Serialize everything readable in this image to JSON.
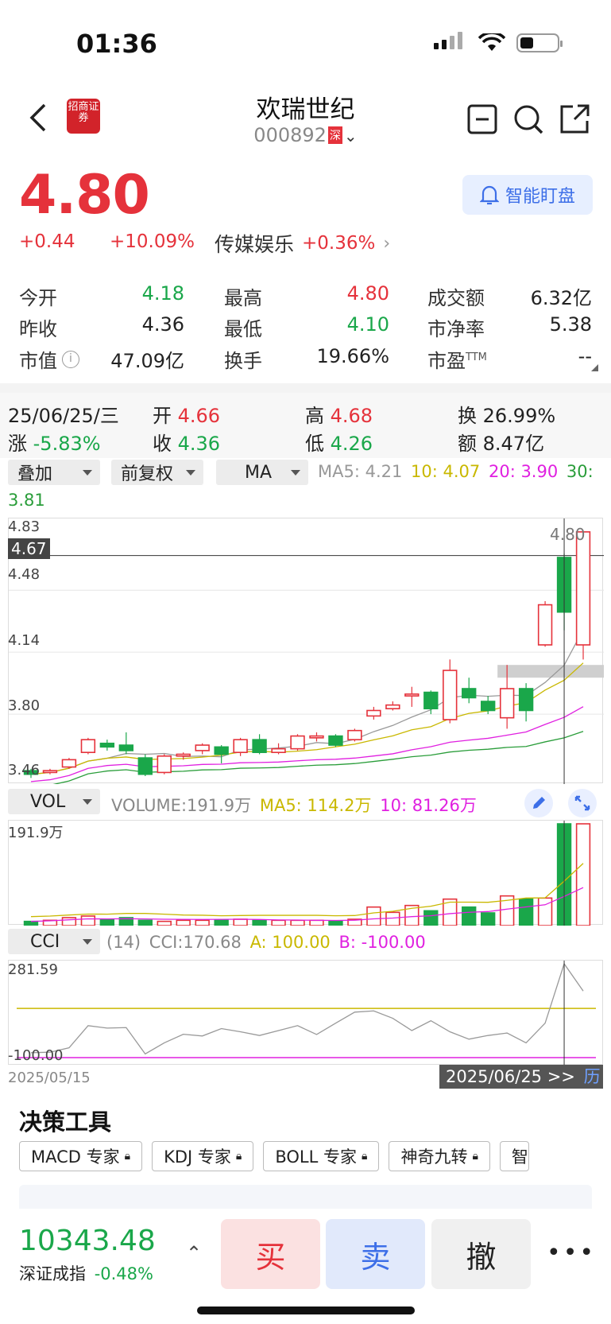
{
  "status": {
    "time": "01:36"
  },
  "header": {
    "title": "欢瑞世纪",
    "code": "000892",
    "exchange_tag": "深",
    "broker_logo_text": "招商证券"
  },
  "quote": {
    "price": "4.80",
    "change": "+0.44",
    "change_pct": "+10.09%",
    "sector": "传媒娱乐",
    "sector_pct": "+0.36%",
    "smart_watch": "智能盯盘"
  },
  "stats": [
    {
      "label": "今开",
      "value": "4.18",
      "color": "green"
    },
    {
      "label": "最高",
      "value": "4.80",
      "color": "red"
    },
    {
      "label": "成交额",
      "value": "6.32亿",
      "color": "black"
    },
    {
      "label": "昨收",
      "value": "4.36",
      "color": "black"
    },
    {
      "label": "最低",
      "value": "4.10",
      "color": "green"
    },
    {
      "label": "市净率",
      "value": "5.38",
      "color": "black"
    },
    {
      "label": "市值",
      "value": "47.09亿",
      "color": "black"
    },
    {
      "label": "换手",
      "value": "19.66%",
      "color": "black"
    },
    {
      "label": "市盈",
      "value": "--",
      "color": "black"
    }
  ],
  "pe_sup": "TTM",
  "day_info": {
    "date": "25/06/25/三",
    "open_label": "开",
    "open": "4.66",
    "high_label": "高",
    "high": "4.68",
    "turnover_label": "换",
    "turnover": "26.99%",
    "chg_label": "涨",
    "chg": "-5.83%",
    "close_label": "收",
    "close": "4.36",
    "low_label": "低",
    "low": "4.26",
    "amount_label": "额",
    "amount": "8.47亿"
  },
  "kline_controls": {
    "overlay": "叠加",
    "adjust": "前复权",
    "indicator": "MA",
    "ma5": "MA5: 4.21",
    "ma10": "10: 4.07",
    "ma20": "20: 3.90",
    "ma30_a": "30:",
    "ma30_b": "3.81"
  },
  "price_axis": {
    "top": "4.83",
    "cursor": "4.67",
    "l2": "4.48",
    "l3": "4.14",
    "l4": "3.80",
    "bottom": "3.46",
    "max_label": "4.80"
  },
  "vol_panel": {
    "selector": "VOL",
    "volume": "VOLUME:191.9万",
    "ma5": "MA5: 114.2万",
    "ma10": "10: 81.26万",
    "axis_top": "191.9万"
  },
  "cci_panel": {
    "selector": "CCI",
    "period": "(14)",
    "cci": "CCI:170.68",
    "a": "A: 100.00",
    "b": "B: -100.00",
    "axis_top": "281.59",
    "axis_bottom": "-100.00",
    "date_start": "2025/05/15",
    "date_cursor": "2025/06/25 >>",
    "history": "历"
  },
  "tools": {
    "title": "决策工具",
    "chips": [
      "MACD 专家",
      "KDJ 专家",
      "BOLL 专家",
      "神奇九转",
      "智"
    ]
  },
  "bottom": {
    "index_value": "10343.48",
    "index_name": "深证成指",
    "index_pct": "-0.48%",
    "buy": "买",
    "sell": "卖",
    "cancel": "撤"
  },
  "colors": {
    "up": "#e5323b",
    "down": "#1aa74a",
    "ma5": "#c9b800",
    "ma10": "#e020e0",
    "ma20": "#2a9d3a"
  },
  "chart_data": {
    "type": "candlestick",
    "x": [
      "2025/05/15",
      "2025/06/25"
    ],
    "candles": [
      {
        "o": 3.49,
        "c": 3.47,
        "h": 3.5,
        "l": 3.45
      },
      {
        "o": 3.48,
        "c": 3.49,
        "h": 3.5,
        "l": 3.47
      },
      {
        "o": 3.51,
        "c": 3.55,
        "h": 3.56,
        "l": 3.5
      },
      {
        "o": 3.59,
        "c": 3.66,
        "h": 3.67,
        "l": 3.58
      },
      {
        "o": 3.64,
        "c": 3.62,
        "h": 3.66,
        "l": 3.6
      },
      {
        "o": 3.63,
        "c": 3.6,
        "h": 3.7,
        "l": 3.58
      },
      {
        "o": 3.56,
        "c": 3.47,
        "h": 3.58,
        "l": 3.46
      },
      {
        "o": 3.48,
        "c": 3.57,
        "h": 3.58,
        "l": 3.47
      },
      {
        "o": 3.57,
        "c": 3.58,
        "h": 3.59,
        "l": 3.55
      },
      {
        "o": 3.6,
        "c": 3.63,
        "h": 3.64,
        "l": 3.58
      },
      {
        "o": 3.62,
        "c": 3.58,
        "h": 3.63,
        "l": 3.53
      },
      {
        "o": 3.59,
        "c": 3.66,
        "h": 3.67,
        "l": 3.57
      },
      {
        "o": 3.66,
        "c": 3.59,
        "h": 3.69,
        "l": 3.58
      },
      {
        "o": 3.59,
        "c": 3.61,
        "h": 3.64,
        "l": 3.58
      },
      {
        "o": 3.61,
        "c": 3.68,
        "h": 3.69,
        "l": 3.6
      },
      {
        "o": 3.67,
        "c": 3.68,
        "h": 3.7,
        "l": 3.65
      },
      {
        "o": 3.68,
        "c": 3.63,
        "h": 3.69,
        "l": 3.62
      },
      {
        "o": 3.66,
        "c": 3.71,
        "h": 3.72,
        "l": 3.65
      },
      {
        "o": 3.79,
        "c": 3.82,
        "h": 3.84,
        "l": 3.77
      },
      {
        "o": 3.83,
        "c": 3.85,
        "h": 3.87,
        "l": 3.82
      },
      {
        "o": 3.9,
        "c": 3.91,
        "h": 3.95,
        "l": 3.84
      },
      {
        "o": 3.92,
        "c": 3.83,
        "h": 3.93,
        "l": 3.8
      },
      {
        "o": 3.77,
        "c": 4.04,
        "h": 4.1,
        "l": 3.75
      },
      {
        "o": 3.94,
        "c": 3.89,
        "h": 4.0,
        "l": 3.86
      },
      {
        "o": 3.87,
        "c": 3.82,
        "h": 3.9,
        "l": 3.8
      },
      {
        "o": 3.78,
        "c": 3.94,
        "h": 4.07,
        "l": 3.72
      },
      {
        "o": 3.94,
        "c": 3.82,
        "h": 3.97,
        "l": 3.76
      },
      {
        "o": 4.18,
        "c": 4.4,
        "h": 4.42,
        "l": 4.17
      },
      {
        "o": 4.66,
        "c": 4.36,
        "h": 4.68,
        "l": 4.26
      },
      {
        "o": 4.18,
        "c": 4.8,
        "h": 4.8,
        "l": 4.1
      }
    ],
    "ylim": [
      3.46,
      4.83
    ],
    "volume": [
      0.08,
      0.1,
      0.15,
      0.18,
      0.12,
      0.15,
      0.1,
      0.08,
      0.1,
      0.1,
      0.1,
      0.12,
      0.1,
      0.1,
      0.1,
      0.1,
      0.08,
      0.12,
      0.35,
      0.25,
      0.38,
      0.28,
      0.5,
      0.35,
      0.24,
      0.56,
      0.5,
      0.52,
      1.92,
      1.92
    ],
    "volume_unit": "万 (×100)",
    "cci": [
      -80,
      -78,
      -60,
      30,
      20,
      22,
      -85,
      -40,
      -5,
      -12,
      18,
      5,
      -10,
      10,
      30,
      -6,
      40,
      85,
      90,
      60,
      10,
      50,
      5,
      -25,
      -10,
      0,
      -40,
      40,
      281.59,
      170.68
    ]
  }
}
